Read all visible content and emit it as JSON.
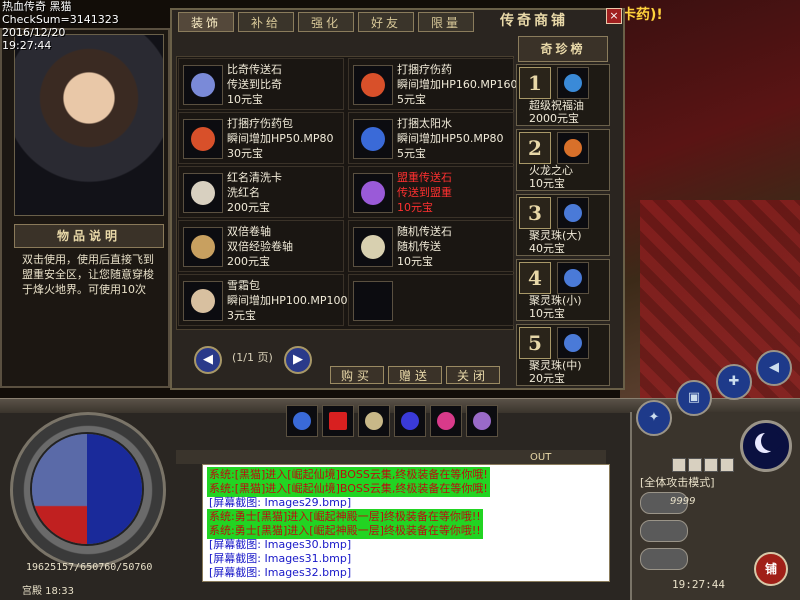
{
  "hud": {
    "title_line": "热血传奇 黑猫",
    "checksum": "CheckSum=3141323",
    "date": "2016/12/20",
    "time_top": "19:27:44",
    "world_notice": "卡药)!"
  },
  "item_info": {
    "header": "物品说明",
    "text": "双击使用，使用后直接飞到盟重安全区，让您随意穿梭于烽火地界。可使用10次"
  },
  "shop": {
    "title": "传奇商铺",
    "close": "×",
    "tabs": [
      {
        "label": "装饰",
        "active": true
      },
      {
        "label": "补给",
        "active": false
      },
      {
        "label": "强化",
        "active": false
      },
      {
        "label": "好友",
        "active": false
      },
      {
        "label": "限量",
        "active": false
      }
    ],
    "items": [
      {
        "name": "比奇传送石",
        "desc": "传送到比奇",
        "price": "10元宝",
        "icon": "scroll-orb-icon",
        "highlight": false
      },
      {
        "name": "打捆疗伤药",
        "desc": "瞬间增加HP160.MP160",
        "price": "5元宝",
        "icon": "potion-bundle-icon",
        "highlight": false
      },
      {
        "name": "打捆疗伤药包",
        "desc": "瞬间增加HP50.MP80",
        "price": "30元宝",
        "icon": "potion-bundle-icon",
        "highlight": false
      },
      {
        "name": "打捆太阳水",
        "desc": "瞬间增加HP50.MP80",
        "price": "5元宝",
        "icon": "sun-water-icon",
        "highlight": false
      },
      {
        "name": "红名清洗卡",
        "desc": "洗红名",
        "price": "200元宝",
        "icon": "card-icon",
        "highlight": false
      },
      {
        "name": "盟重传送石",
        "desc": "传送到盟重",
        "price": "10元宝",
        "icon": "purple-stone-icon",
        "highlight": true
      },
      {
        "name": "双倍卷轴",
        "desc": "双倍经验卷轴",
        "price": "200元宝",
        "icon": "scroll-icon",
        "highlight": false
      },
      {
        "name": "随机传送石",
        "desc": "随机传送",
        "price": "10元宝",
        "icon": "random-stone-icon",
        "highlight": false
      },
      {
        "name": "雪霜包",
        "desc": "瞬间增加HP100.MP100",
        "price": "3元宝",
        "icon": "snow-pack-icon",
        "highlight": false
      },
      {
        "name": "",
        "desc": "",
        "price": "",
        "icon": "",
        "highlight": false
      }
    ],
    "page_text": "(1/1 页)",
    "buy_label": "购买",
    "gift_label": "赠送",
    "close_label": "关闭"
  },
  "rare_list": {
    "header": "奇珍榜",
    "entries": [
      {
        "rank": "1",
        "name": "超级祝福油",
        "price": "2000元宝",
        "icon": "blessing-oil-icon"
      },
      {
        "rank": "2",
        "name": "火龙之心",
        "price": "10元宝",
        "icon": "dragon-heart-icon"
      },
      {
        "rank": "3",
        "name": "聚灵珠(大)",
        "price": "40元宝",
        "icon": "spirit-orb-icon"
      },
      {
        "rank": "4",
        "name": "聚灵珠(小)",
        "price": "10元宝",
        "icon": "spirit-orb-icon"
      },
      {
        "rank": "5",
        "name": "聚灵珠(中)",
        "price": "20元宝",
        "icon": "spirit-orb-icon"
      }
    ]
  },
  "status": {
    "stats": "19625157/650760/50760",
    "map": "宫殿 18:33",
    "attack_mode": "[全体攻击模式]",
    "clock": "19:27:44",
    "shop_button": "铺",
    "gauge1": "9999",
    "gauge2": "",
    "gauge3": ""
  },
  "chat": {
    "out_label": "OUT",
    "lines": [
      {
        "type": "sys",
        "text": "系统:[黑猫]进入[崛起仙境]BOSS云集,终极装备在等你哦!"
      },
      {
        "type": "sys",
        "text": "系统:[黑猫]进入[崛起仙境]BOSS云集,终极装备在等你哦!"
      },
      {
        "type": "shot",
        "text": "[屏幕截图: Images29.bmp]"
      },
      {
        "type": "sys",
        "text": "系统:勇士[黑猫]进入[崛起神殿一层]终极装备在等你哦!!"
      },
      {
        "type": "sys",
        "text": "系统:勇士[黑猫]进入[崛起神殿一层]终极装备在等你哦!!"
      },
      {
        "type": "shot",
        "text": "[屏幕截图: Images30.bmp]"
      },
      {
        "type": "shot",
        "text": "[屏幕截图: Images31.bmp]"
      },
      {
        "type": "shot",
        "text": "[屏幕截图: Images32.bmp]"
      }
    ]
  },
  "colors": {
    "highlight_red": "#ff3030",
    "chat_sys_bg": "#22d422",
    "chat_sys_fg": "#b81010",
    "chat_shot_fg": "#1818c8"
  }
}
